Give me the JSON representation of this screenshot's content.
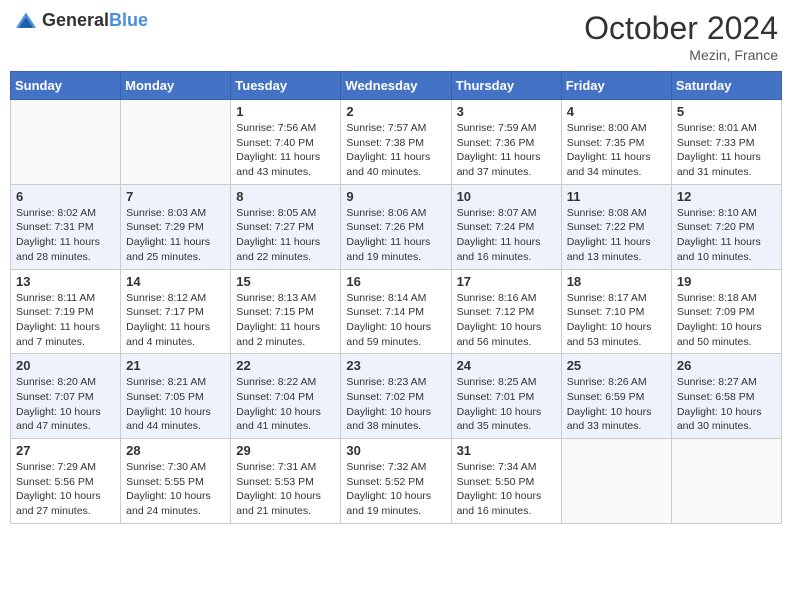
{
  "header": {
    "logo_general": "General",
    "logo_blue": "Blue",
    "month_title": "October 2024",
    "location": "Mezin, France"
  },
  "days_of_week": [
    "Sunday",
    "Monday",
    "Tuesday",
    "Wednesday",
    "Thursday",
    "Friday",
    "Saturday"
  ],
  "weeks": [
    [
      {
        "day": "",
        "sunrise": "",
        "sunset": "",
        "daylight": ""
      },
      {
        "day": "",
        "sunrise": "",
        "sunset": "",
        "daylight": ""
      },
      {
        "day": "1",
        "sunrise": "Sunrise: 7:56 AM",
        "sunset": "Sunset: 7:40 PM",
        "daylight": "Daylight: 11 hours and 43 minutes."
      },
      {
        "day": "2",
        "sunrise": "Sunrise: 7:57 AM",
        "sunset": "Sunset: 7:38 PM",
        "daylight": "Daylight: 11 hours and 40 minutes."
      },
      {
        "day": "3",
        "sunrise": "Sunrise: 7:59 AM",
        "sunset": "Sunset: 7:36 PM",
        "daylight": "Daylight: 11 hours and 37 minutes."
      },
      {
        "day": "4",
        "sunrise": "Sunrise: 8:00 AM",
        "sunset": "Sunset: 7:35 PM",
        "daylight": "Daylight: 11 hours and 34 minutes."
      },
      {
        "day": "5",
        "sunrise": "Sunrise: 8:01 AM",
        "sunset": "Sunset: 7:33 PM",
        "daylight": "Daylight: 11 hours and 31 minutes."
      }
    ],
    [
      {
        "day": "6",
        "sunrise": "Sunrise: 8:02 AM",
        "sunset": "Sunset: 7:31 PM",
        "daylight": "Daylight: 11 hours and 28 minutes."
      },
      {
        "day": "7",
        "sunrise": "Sunrise: 8:03 AM",
        "sunset": "Sunset: 7:29 PM",
        "daylight": "Daylight: 11 hours and 25 minutes."
      },
      {
        "day": "8",
        "sunrise": "Sunrise: 8:05 AM",
        "sunset": "Sunset: 7:27 PM",
        "daylight": "Daylight: 11 hours and 22 minutes."
      },
      {
        "day": "9",
        "sunrise": "Sunrise: 8:06 AM",
        "sunset": "Sunset: 7:26 PM",
        "daylight": "Daylight: 11 hours and 19 minutes."
      },
      {
        "day": "10",
        "sunrise": "Sunrise: 8:07 AM",
        "sunset": "Sunset: 7:24 PM",
        "daylight": "Daylight: 11 hours and 16 minutes."
      },
      {
        "day": "11",
        "sunrise": "Sunrise: 8:08 AM",
        "sunset": "Sunset: 7:22 PM",
        "daylight": "Daylight: 11 hours and 13 minutes."
      },
      {
        "day": "12",
        "sunrise": "Sunrise: 8:10 AM",
        "sunset": "Sunset: 7:20 PM",
        "daylight": "Daylight: 11 hours and 10 minutes."
      }
    ],
    [
      {
        "day": "13",
        "sunrise": "Sunrise: 8:11 AM",
        "sunset": "Sunset: 7:19 PM",
        "daylight": "Daylight: 11 hours and 7 minutes."
      },
      {
        "day": "14",
        "sunrise": "Sunrise: 8:12 AM",
        "sunset": "Sunset: 7:17 PM",
        "daylight": "Daylight: 11 hours and 4 minutes."
      },
      {
        "day": "15",
        "sunrise": "Sunrise: 8:13 AM",
        "sunset": "Sunset: 7:15 PM",
        "daylight": "Daylight: 11 hours and 2 minutes."
      },
      {
        "day": "16",
        "sunrise": "Sunrise: 8:14 AM",
        "sunset": "Sunset: 7:14 PM",
        "daylight": "Daylight: 10 hours and 59 minutes."
      },
      {
        "day": "17",
        "sunrise": "Sunrise: 8:16 AM",
        "sunset": "Sunset: 7:12 PM",
        "daylight": "Daylight: 10 hours and 56 minutes."
      },
      {
        "day": "18",
        "sunrise": "Sunrise: 8:17 AM",
        "sunset": "Sunset: 7:10 PM",
        "daylight": "Daylight: 10 hours and 53 minutes."
      },
      {
        "day": "19",
        "sunrise": "Sunrise: 8:18 AM",
        "sunset": "Sunset: 7:09 PM",
        "daylight": "Daylight: 10 hours and 50 minutes."
      }
    ],
    [
      {
        "day": "20",
        "sunrise": "Sunrise: 8:20 AM",
        "sunset": "Sunset: 7:07 PM",
        "daylight": "Daylight: 10 hours and 47 minutes."
      },
      {
        "day": "21",
        "sunrise": "Sunrise: 8:21 AM",
        "sunset": "Sunset: 7:05 PM",
        "daylight": "Daylight: 10 hours and 44 minutes."
      },
      {
        "day": "22",
        "sunrise": "Sunrise: 8:22 AM",
        "sunset": "Sunset: 7:04 PM",
        "daylight": "Daylight: 10 hours and 41 minutes."
      },
      {
        "day": "23",
        "sunrise": "Sunrise: 8:23 AM",
        "sunset": "Sunset: 7:02 PM",
        "daylight": "Daylight: 10 hours and 38 minutes."
      },
      {
        "day": "24",
        "sunrise": "Sunrise: 8:25 AM",
        "sunset": "Sunset: 7:01 PM",
        "daylight": "Daylight: 10 hours and 35 minutes."
      },
      {
        "day": "25",
        "sunrise": "Sunrise: 8:26 AM",
        "sunset": "Sunset: 6:59 PM",
        "daylight": "Daylight: 10 hours and 33 minutes."
      },
      {
        "day": "26",
        "sunrise": "Sunrise: 8:27 AM",
        "sunset": "Sunset: 6:58 PM",
        "daylight": "Daylight: 10 hours and 30 minutes."
      }
    ],
    [
      {
        "day": "27",
        "sunrise": "Sunrise: 7:29 AM",
        "sunset": "Sunset: 5:56 PM",
        "daylight": "Daylight: 10 hours and 27 minutes."
      },
      {
        "day": "28",
        "sunrise": "Sunrise: 7:30 AM",
        "sunset": "Sunset: 5:55 PM",
        "daylight": "Daylight: 10 hours and 24 minutes."
      },
      {
        "day": "29",
        "sunrise": "Sunrise: 7:31 AM",
        "sunset": "Sunset: 5:53 PM",
        "daylight": "Daylight: 10 hours and 21 minutes."
      },
      {
        "day": "30",
        "sunrise": "Sunrise: 7:32 AM",
        "sunset": "Sunset: 5:52 PM",
        "daylight": "Daylight: 10 hours and 19 minutes."
      },
      {
        "day": "31",
        "sunrise": "Sunrise: 7:34 AM",
        "sunset": "Sunset: 5:50 PM",
        "daylight": "Daylight: 10 hours and 16 minutes."
      },
      {
        "day": "",
        "sunrise": "",
        "sunset": "",
        "daylight": ""
      },
      {
        "day": "",
        "sunrise": "",
        "sunset": "",
        "daylight": ""
      }
    ]
  ]
}
